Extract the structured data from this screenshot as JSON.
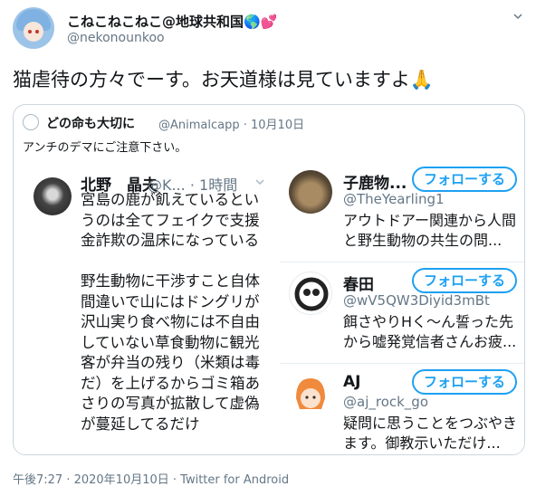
{
  "author": {
    "display_name": "こねこねこねこ@地球共和国",
    "display_emojis": "🌎💕",
    "handle": "@nekonounkoo"
  },
  "tweet_text": "猫虐待の方々でーす。お天道様は見ていますよ🙏",
  "quoted": {
    "display_name": "どの命も大切に",
    "handle": "@Animalcapp · 10月10日",
    "text": "アンチのデマにご注意下さい。",
    "screenshot": {
      "left_tweet": {
        "name": "北野　晶夫",
        "handle": "@K... · 1時間",
        "lines_para1": [
          "宮島の鹿が飢えているとい",
          "うのは全てフェイクで支援",
          "金詐欺の温床になっている"
        ],
        "lines_para2": [
          "野生動物に干渉すこと自体",
          "間違いで山にはドングリが",
          "沢山実り食べ物には不自由",
          "していない草食動物に観光",
          "客が弁当の残り（米類は毒",
          "だ）を上げるからゴミ箱あ",
          "さりの写真が拡散して虚偽",
          "が蔓延してるだけ"
        ]
      },
      "user_cards": [
        {
          "name": "子鹿物...",
          "handle": "@TheYearling1",
          "bio": "アウトドアー関連から人間と野生動物の共生の問...",
          "follow_label": "フォローする"
        },
        {
          "name": "春田",
          "handle": "@wV5QW3Diyid3mBt",
          "bio": "餌さやりHく～ん誓った先から嘘発覚信者さんお疲...",
          "follow_label": "フォローする"
        },
        {
          "name": "AJ",
          "handle": "@aj_rock_go",
          "bio": "疑問に思うことをつぶやきます。御教示いただけ...",
          "follow_label": "フォローする"
        }
      ]
    }
  },
  "footer": "午後7:27 · 2020年10月10日 · Twitter for Android",
  "colors": {
    "accent": "#1da1f2",
    "secondary_text": "#657786",
    "border": "#ccd6dd"
  }
}
